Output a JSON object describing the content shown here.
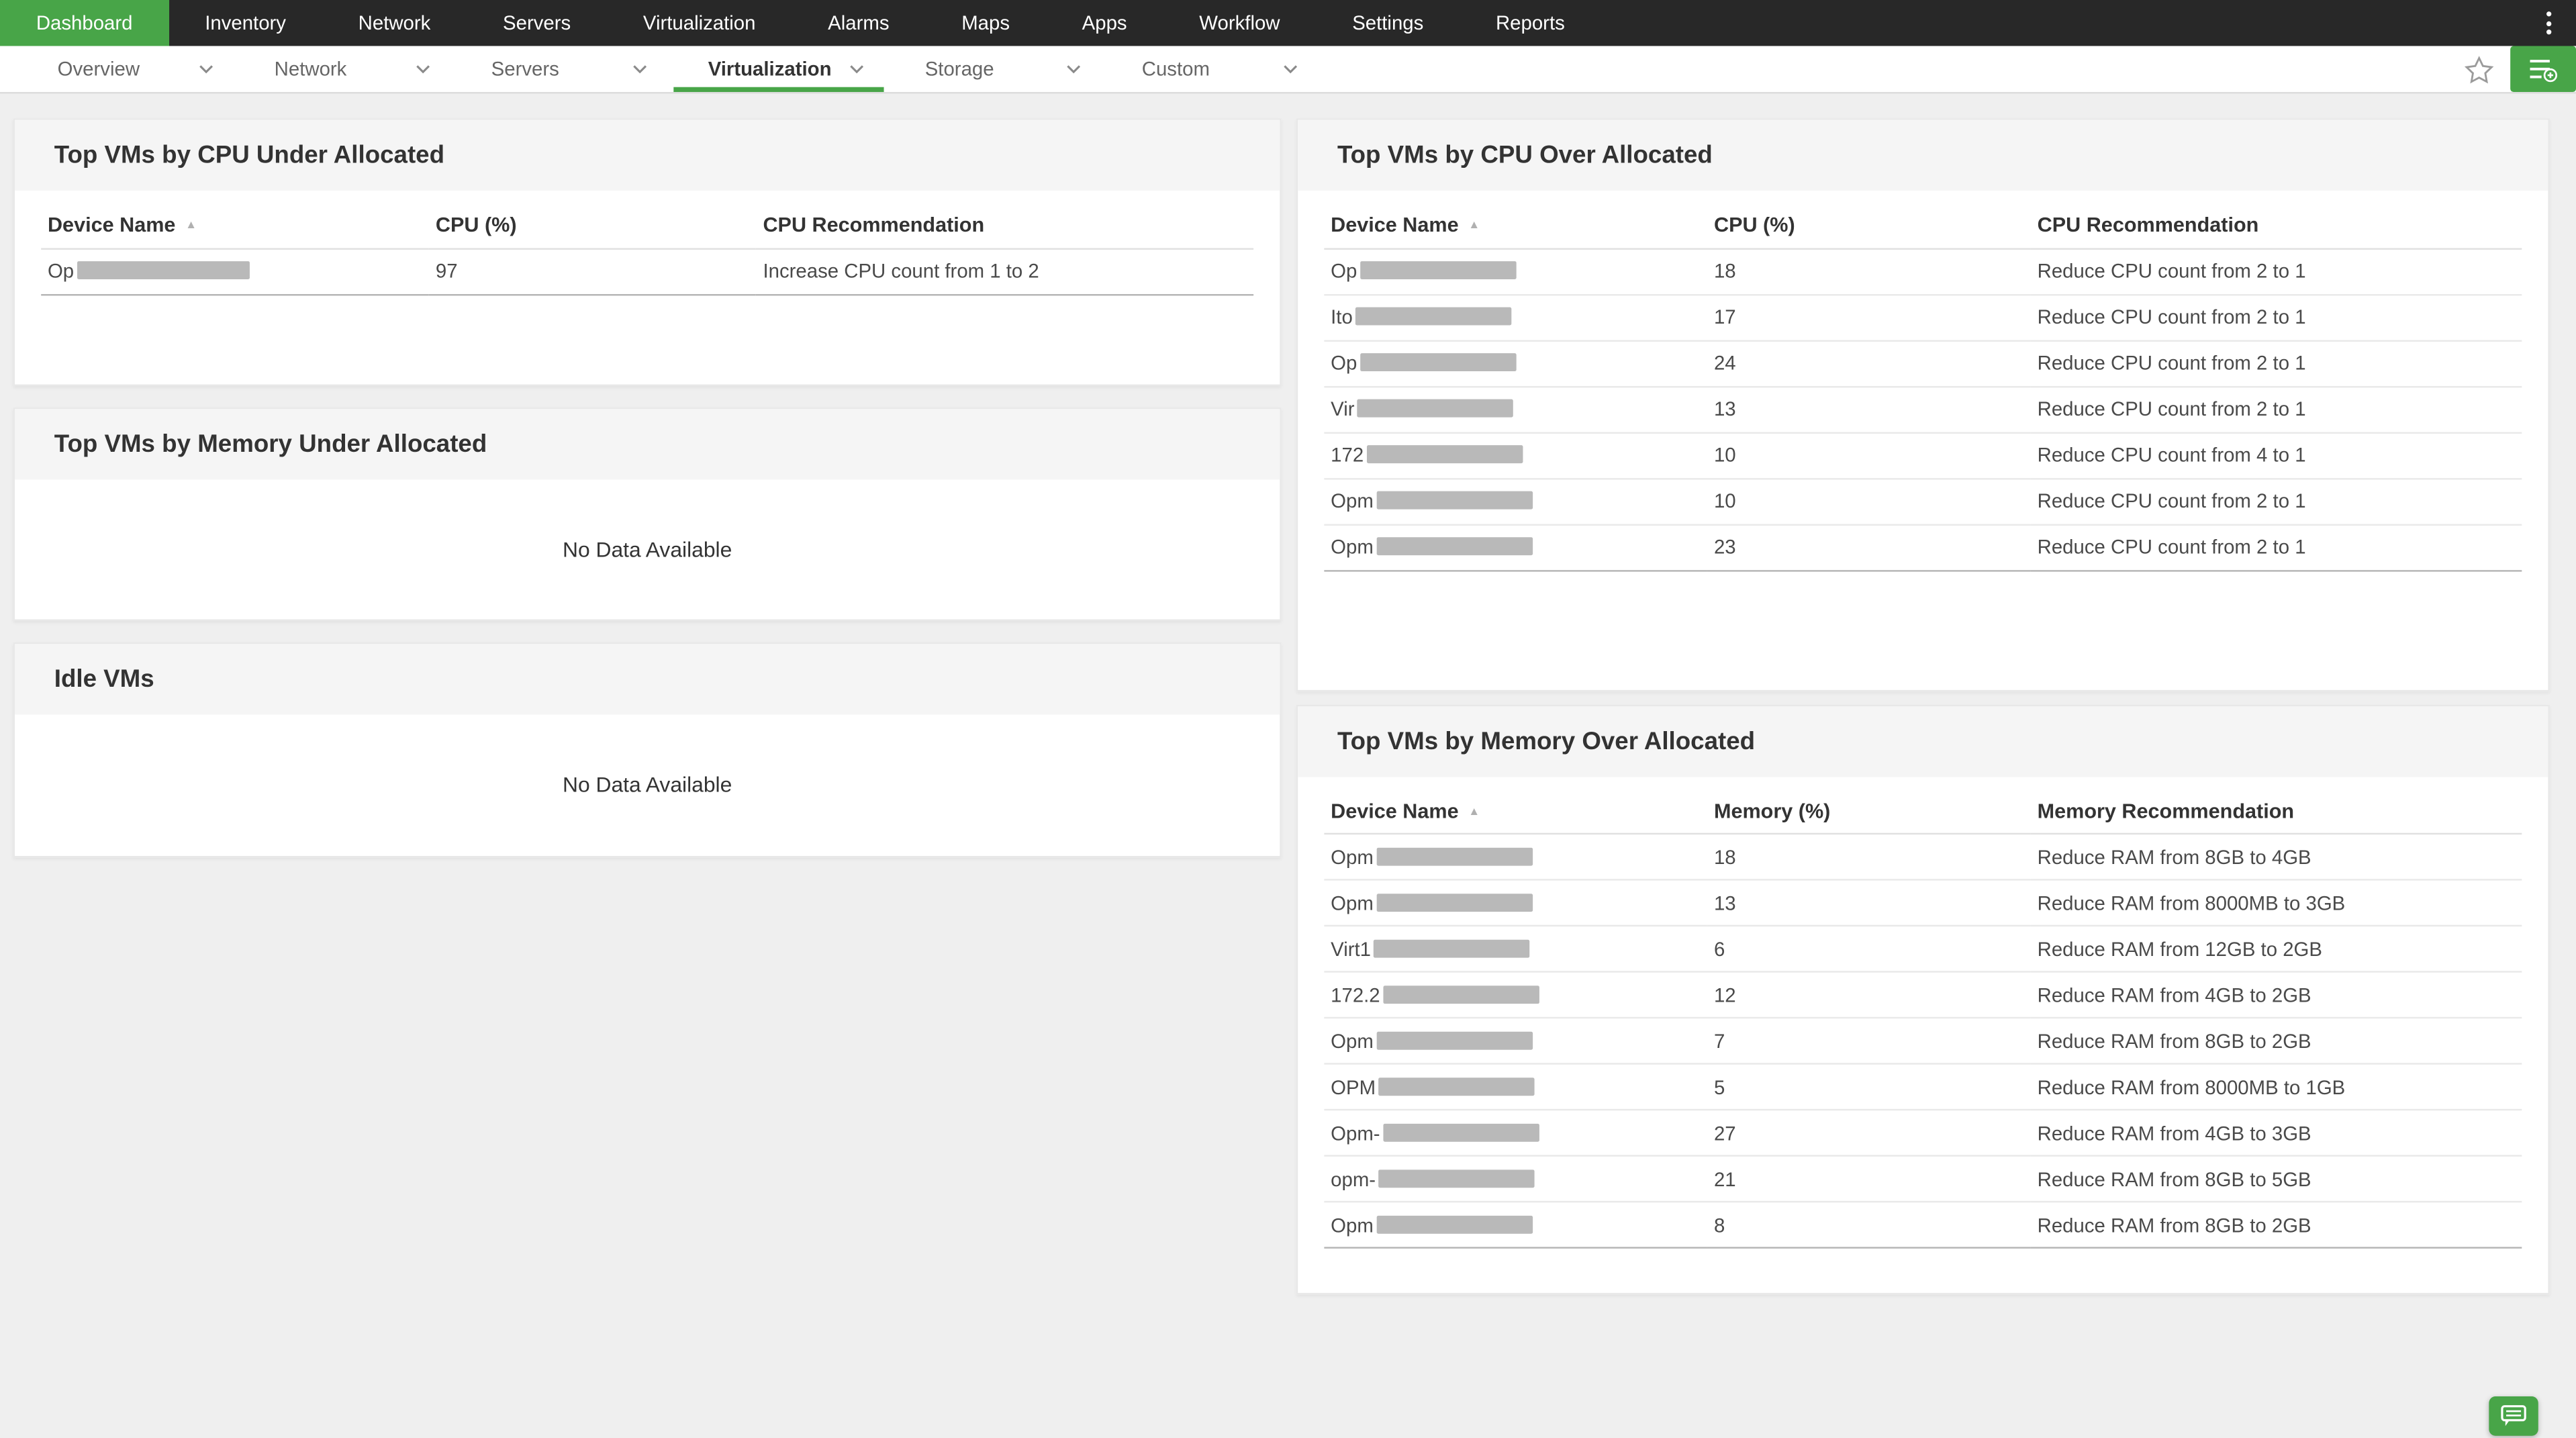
{
  "topnav": {
    "items": [
      {
        "label": "Dashboard",
        "active": true
      },
      {
        "label": "Inventory"
      },
      {
        "label": "Network"
      },
      {
        "label": "Servers"
      },
      {
        "label": "Virtualization"
      },
      {
        "label": "Alarms"
      },
      {
        "label": "Maps"
      },
      {
        "label": "Apps"
      },
      {
        "label": "Workflow"
      },
      {
        "label": "Settings"
      },
      {
        "label": "Reports"
      }
    ],
    "overflow_menu_icon": "kebab-menu-icon"
  },
  "tabbar": {
    "tabs": [
      {
        "label": "Overview"
      },
      {
        "label": "Network"
      },
      {
        "label": "Servers"
      },
      {
        "label": "Virtualization",
        "active": true
      },
      {
        "label": "Storage"
      },
      {
        "label": "Custom"
      }
    ],
    "favorite_icon": "star-icon",
    "add_widget_icon": "add-widget-icon"
  },
  "cards": {
    "cpu_under": {
      "title": "Top VMs by CPU Under Allocated",
      "columns": [
        "Device Name",
        "CPU (%)",
        "CPU Recommendation"
      ],
      "sort_icon": "sort-ascending-icon",
      "rows": [
        {
          "device_prefix": "Op",
          "value": "97",
          "recommendation": "Increase CPU count from 1 to 2"
        }
      ]
    },
    "memory_under": {
      "title": "Top VMs by Memory Under Allocated",
      "empty_text": "No Data Available"
    },
    "idle_vms": {
      "title": "Idle VMs",
      "empty_text": "No Data Available"
    },
    "cpu_over": {
      "title": "Top VMs by CPU Over Allocated",
      "columns": [
        "Device Name",
        "CPU (%)",
        "CPU Recommendation"
      ],
      "sort_icon": "sort-ascending-icon",
      "rows": [
        {
          "device_prefix": "Op",
          "value": "18",
          "recommendation": "Reduce CPU count from 2 to 1"
        },
        {
          "device_prefix": "Ito",
          "value": "17",
          "recommendation": "Reduce CPU count from 2 to 1"
        },
        {
          "device_prefix": "Op",
          "value": "24",
          "recommendation": "Reduce CPU count from 2 to 1"
        },
        {
          "device_prefix": "Vir",
          "value": "13",
          "recommendation": "Reduce CPU count from 2 to 1"
        },
        {
          "device_prefix": "172",
          "value": "10",
          "recommendation": "Reduce CPU count from 4 to 1"
        },
        {
          "device_prefix": "Opm",
          "value": "10",
          "recommendation": "Reduce CPU count from 2 to 1"
        },
        {
          "device_prefix": "Opm",
          "value": "23",
          "recommendation": "Reduce CPU count from 2 to 1"
        }
      ]
    },
    "memory_over": {
      "title": "Top VMs by Memory Over Allocated",
      "columns": [
        "Device Name",
        "Memory (%)",
        "Memory Recommendation"
      ],
      "sort_icon": "sort-ascending-icon",
      "rows": [
        {
          "device_prefix": "Opm",
          "value": "18",
          "recommendation": "Reduce RAM from 8GB to 4GB"
        },
        {
          "device_prefix": "Opm",
          "value": "13",
          "recommendation": "Reduce RAM from 8000MB to 3GB"
        },
        {
          "device_prefix": "Virt1",
          "value": "6",
          "recommendation": "Reduce RAM from 12GB to 2GB"
        },
        {
          "device_prefix": "172.2",
          "value": "12",
          "recommendation": "Reduce RAM from 4GB to 2GB"
        },
        {
          "device_prefix": "Opm",
          "value": "7",
          "recommendation": "Reduce RAM from 8GB to 2GB"
        },
        {
          "device_prefix": "OPM",
          "value": "5",
          "recommendation": "Reduce RAM from 8000MB to 1GB"
        },
        {
          "device_prefix": "Opm-",
          "value": "27",
          "recommendation": "Reduce RAM from 4GB to 3GB"
        },
        {
          "device_prefix": "opm-",
          "value": "21",
          "recommendation": "Reduce RAM from 8GB to 5GB"
        },
        {
          "device_prefix": "Opm",
          "value": "8",
          "recommendation": "Reduce RAM from 8GB to 2GB"
        }
      ]
    }
  },
  "floating": {
    "chat_icon": "chat-icon"
  },
  "colors": {
    "accent_green": "#48a548",
    "nav_bg": "#282828",
    "page_bg": "#efefef",
    "card_header_bg": "#f5f5f5",
    "redaction_gray": "#b9b9b9"
  }
}
